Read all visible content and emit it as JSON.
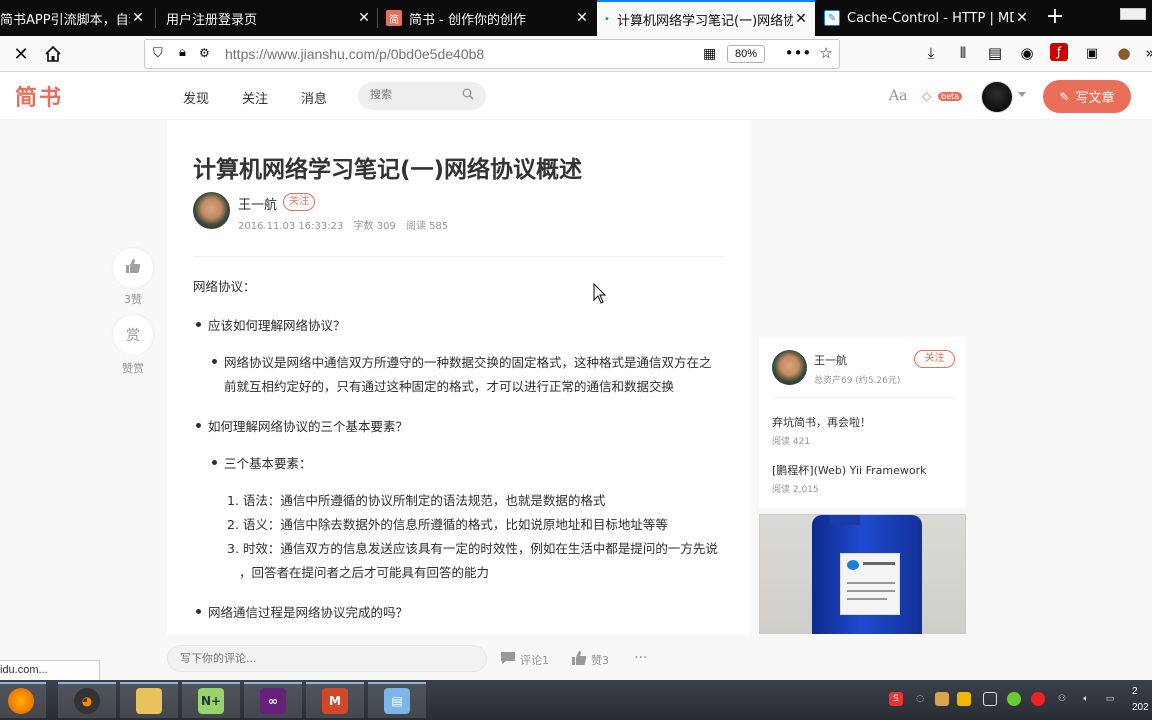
{
  "browser": {
    "tabs": [
      {
        "label": "简书APP引流脚本，自动",
        "close": "✕"
      },
      {
        "label": "用户注册登录页",
        "close": "✕"
      },
      {
        "label": "简书 - 创作你的创作",
        "close": "✕",
        "favicon": "简"
      },
      {
        "label": "计算机网络学习笔记(一)网络协",
        "close": "✕",
        "active": true
      },
      {
        "label": "Cache-Control - HTTP | MDN",
        "close": "✕"
      }
    ],
    "new_tab": "+",
    "url_host": "https://www.jianshu.com",
    "url_path": "/p/0bd0e5de40b8",
    "zoom": "80%"
  },
  "site": {
    "logo": "简书",
    "nav": [
      "发现",
      "关注",
      "消息"
    ],
    "search_placeholder": "搜索",
    "aa": "Aa",
    "beta": "beta",
    "write": "写文章"
  },
  "article": {
    "title": "计算机网络学习笔记(一)网络协议概述",
    "author": "王一航",
    "follow": "关注",
    "date": "2016.11.03 16:33:23",
    "words": "字数 309",
    "reads": "阅读 585",
    "body": {
      "p1": "网络协议：",
      "q1": "应该如何理解网络协议？",
      "a1_line1": "网络协议是网络中通信双方所遵守的一种数据交换的固定格式，这种格式是通信双方在之",
      "a1_line2": "前就互相约定好的，只有通过这种固定的格式，才可以进行正常的通信和数据交换",
      "q2": "如何理解网络协议的三个基本要素？",
      "sub": "三个基本要素：",
      "l1": "1. 语法：通信中所遵循的协议所制定的语法规范，也就是数据的格式",
      "l2": "2. 语义：通信中除去数据外的信息所遵循的格式，比如说原地址和目标地址等等",
      "l3_line1": "3. 时效：通信双方的信息发送应该具有一定的时效性，例如在生活中都是提问的一方先说",
      "l3_line2": "，回答者在提问者之后才可能具有回答的能力",
      "q3": "网络通信过程是网络协议完成的吗？"
    }
  },
  "side_actions": {
    "like_count": "3赞",
    "reward_icon": "赏",
    "reward_label": "赞赏"
  },
  "author_card": {
    "name": "王一航",
    "assets": "总资产69 (约5.26元)",
    "follow": "关注",
    "posts": [
      {
        "title": "弃坑简书，再会啦！",
        "reads": "阅读 421"
      },
      {
        "title": "[鹏程杯](Web) Yii Framework",
        "reads": "阅读 2,015"
      }
    ]
  },
  "footer": {
    "comment_placeholder": "写下你的评论...",
    "comments": "评论1",
    "likes": "赞3",
    "more": "···"
  },
  "statusbar": "idu.com...",
  "clock": {
    "line1": "2",
    "line2": "202"
  }
}
